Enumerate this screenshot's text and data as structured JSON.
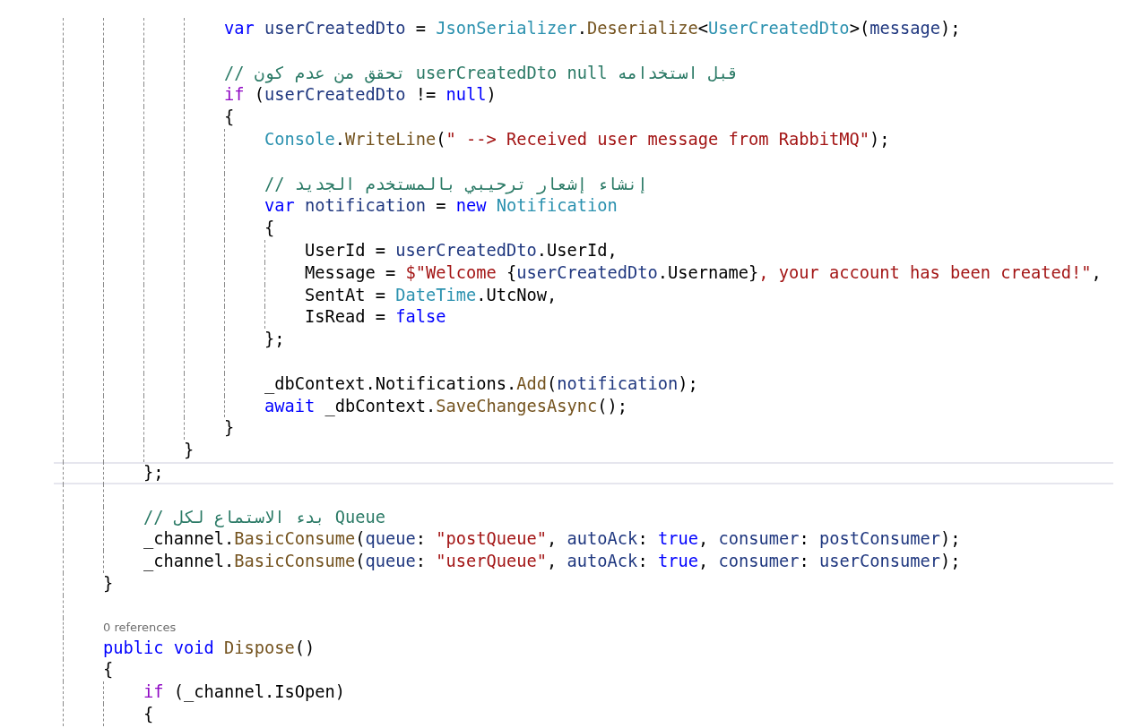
{
  "editor": {
    "lines": [
      {
        "kind": "block",
        "children": [
          {
            "kind": "block",
            "children": [
              {
                "kind": "block",
                "children": [
                  {
                    "kind": "block",
                    "children": [
                      {
                        "kind": "code",
                        "current": false,
                        "tokens": [
                          {
                            "kind": "keyword",
                            "text": "var"
                          },
                          {
                            "kind": "variable",
                            "text": " userCreatedDto"
                          },
                          {
                            "kind": "plain",
                            "text": " = "
                          },
                          {
                            "kind": "type",
                            "text": "JsonSerializer"
                          },
                          {
                            "kind": "plain",
                            "text": "."
                          },
                          {
                            "kind": "method",
                            "text": "Deserialize"
                          },
                          {
                            "kind": "plain",
                            "text": "<"
                          },
                          {
                            "kind": "type",
                            "text": "UserCreatedDto"
                          },
                          {
                            "kind": "plain",
                            "text": ">("
                          },
                          {
                            "kind": "variable",
                            "text": "message"
                          },
                          {
                            "kind": "plain",
                            "text": ");"
                          }
                        ]
                      },
                      {
                        "kind": "blank",
                        "current": false
                      },
                      {
                        "kind": "code",
                        "current": false,
                        "tokens": [
                          {
                            "kind": "comment",
                            "text": "// تحقق من عدم كون userCreatedDto null قبل استخدامه"
                          }
                        ]
                      },
                      {
                        "kind": "code",
                        "current": false,
                        "tokens": [
                          {
                            "kind": "control",
                            "text": "if"
                          },
                          {
                            "kind": "plain",
                            "text": " ("
                          },
                          {
                            "kind": "variable",
                            "text": "userCreatedDto"
                          },
                          {
                            "kind": "plain",
                            "text": " != "
                          },
                          {
                            "kind": "keyword",
                            "text": "null"
                          },
                          {
                            "kind": "plain",
                            "text": ")"
                          }
                        ]
                      },
                      {
                        "kind": "code",
                        "current": false,
                        "tokens": [
                          {
                            "kind": "plain",
                            "text": "{"
                          }
                        ]
                      },
                      {
                        "kind": "block",
                        "children": [
                          {
                            "kind": "code",
                            "current": false,
                            "tokens": [
                              {
                                "kind": "type",
                                "text": "Console"
                              },
                              {
                                "kind": "plain",
                                "text": "."
                              },
                              {
                                "kind": "method",
                                "text": "WriteLine"
                              },
                              {
                                "kind": "plain",
                                "text": "("
                              },
                              {
                                "kind": "string",
                                "text": "\" --> Received user message from RabbitMQ\""
                              },
                              {
                                "kind": "plain",
                                "text": ");"
                              }
                            ]
                          },
                          {
                            "kind": "blank",
                            "current": false
                          },
                          {
                            "kind": "code",
                            "current": false,
                            "tokens": [
                              {
                                "kind": "comment",
                                "text": "// إنشاء إشعار ترحيبي بالمستخدم الجديد"
                              }
                            ]
                          },
                          {
                            "kind": "code",
                            "current": false,
                            "tokens": [
                              {
                                "kind": "keyword",
                                "text": "var"
                              },
                              {
                                "kind": "variable",
                                "text": " notification"
                              },
                              {
                                "kind": "plain",
                                "text": " = "
                              },
                              {
                                "kind": "keyword",
                                "text": "new"
                              },
                              {
                                "kind": "type",
                                "text": " Notification"
                              }
                            ]
                          },
                          {
                            "kind": "code",
                            "current": false,
                            "tokens": [
                              {
                                "kind": "plain",
                                "text": "{"
                              }
                            ]
                          },
                          {
                            "kind": "block",
                            "children": [
                              {
                                "kind": "code",
                                "current": false,
                                "tokens": [
                                  {
                                    "kind": "plain",
                                    "text": "UserId = "
                                  },
                                  {
                                    "kind": "variable",
                                    "text": "userCreatedDto"
                                  },
                                  {
                                    "kind": "plain",
                                    "text": ".UserId,"
                                  }
                                ]
                              },
                              {
                                "kind": "code",
                                "current": false,
                                "tokens": [
                                  {
                                    "kind": "plain",
                                    "text": "Message = "
                                  },
                                  {
                                    "kind": "string",
                                    "text": "$\"Welcome "
                                  },
                                  {
                                    "kind": "plain",
                                    "text": "{"
                                  },
                                  {
                                    "kind": "variable",
                                    "text": "userCreatedDto"
                                  },
                                  {
                                    "kind": "plain",
                                    "text": ".Username}"
                                  },
                                  {
                                    "kind": "string",
                                    "text": ", your account has been created!\""
                                  },
                                  {
                                    "kind": "plain",
                                    "text": ","
                                  }
                                ]
                              },
                              {
                                "kind": "code",
                                "current": false,
                                "tokens": [
                                  {
                                    "kind": "plain",
                                    "text": "SentAt = "
                                  },
                                  {
                                    "kind": "type",
                                    "text": "DateTime"
                                  },
                                  {
                                    "kind": "plain",
                                    "text": ".UtcNow,"
                                  }
                                ]
                              },
                              {
                                "kind": "code",
                                "current": false,
                                "tokens": [
                                  {
                                    "kind": "plain",
                                    "text": "IsRead = "
                                  },
                                  {
                                    "kind": "keyword",
                                    "text": "false"
                                  }
                                ]
                              }
                            ]
                          },
                          {
                            "kind": "code",
                            "current": false,
                            "tokens": [
                              {
                                "kind": "plain",
                                "text": "};"
                              }
                            ]
                          },
                          {
                            "kind": "blank",
                            "current": false
                          },
                          {
                            "kind": "code",
                            "current": false,
                            "tokens": [
                              {
                                "kind": "plain",
                                "text": "_dbContext.Notifications."
                              },
                              {
                                "kind": "method",
                                "text": "Add"
                              },
                              {
                                "kind": "plain",
                                "text": "("
                              },
                              {
                                "kind": "variable",
                                "text": "notification"
                              },
                              {
                                "kind": "plain",
                                "text": ");"
                              }
                            ]
                          },
                          {
                            "kind": "code",
                            "current": false,
                            "tokens": [
                              {
                                "kind": "keyword",
                                "text": "await"
                              },
                              {
                                "kind": "plain",
                                "text": " _dbContext."
                              },
                              {
                                "kind": "method",
                                "text": "SaveChangesAsync"
                              },
                              {
                                "kind": "plain",
                                "text": "();"
                              }
                            ]
                          }
                        ]
                      },
                      {
                        "kind": "code",
                        "current": false,
                        "tokens": [
                          {
                            "kind": "plain",
                            "text": "}"
                          }
                        ]
                      }
                    ]
                  },
                  {
                    "kind": "code",
                    "current": false,
                    "tokens": [
                      {
                        "kind": "plain",
                        "text": "}"
                      }
                    ]
                  }
                ]
              },
              {
                "kind": "code",
                "current": true,
                "tokens": [
                  {
                    "kind": "plain",
                    "text": "};"
                  }
                ]
              },
              {
                "kind": "blank",
                "current": false
              },
              {
                "kind": "code",
                "current": false,
                "tokens": [
                  {
                    "kind": "comment",
                    "text": "// بدء الاستماع لكل Queue"
                  }
                ]
              },
              {
                "kind": "code",
                "current": false,
                "tokens": [
                  {
                    "kind": "plain",
                    "text": "_channel."
                  },
                  {
                    "kind": "method",
                    "text": "BasicConsume"
                  },
                  {
                    "kind": "plain",
                    "text": "("
                  },
                  {
                    "kind": "variable",
                    "text": "queue"
                  },
                  {
                    "kind": "plain",
                    "text": ": "
                  },
                  {
                    "kind": "string",
                    "text": "\"postQueue\""
                  },
                  {
                    "kind": "plain",
                    "text": ", "
                  },
                  {
                    "kind": "variable",
                    "text": "autoAck"
                  },
                  {
                    "kind": "plain",
                    "text": ": "
                  },
                  {
                    "kind": "keyword",
                    "text": "true"
                  },
                  {
                    "kind": "plain",
                    "text": ", "
                  },
                  {
                    "kind": "variable",
                    "text": "consumer"
                  },
                  {
                    "kind": "plain",
                    "text": ": "
                  },
                  {
                    "kind": "variable",
                    "text": "postConsumer"
                  },
                  {
                    "kind": "plain",
                    "text": ");"
                  }
                ]
              },
              {
                "kind": "code",
                "current": false,
                "tokens": [
                  {
                    "kind": "plain",
                    "text": "_channel."
                  },
                  {
                    "kind": "method",
                    "text": "BasicConsume"
                  },
                  {
                    "kind": "plain",
                    "text": "("
                  },
                  {
                    "kind": "variable",
                    "text": "queue"
                  },
                  {
                    "kind": "plain",
                    "text": ": "
                  },
                  {
                    "kind": "string",
                    "text": "\"userQueue\""
                  },
                  {
                    "kind": "plain",
                    "text": ", "
                  },
                  {
                    "kind": "variable",
                    "text": "autoAck"
                  },
                  {
                    "kind": "plain",
                    "text": ": "
                  },
                  {
                    "kind": "keyword",
                    "text": "true"
                  },
                  {
                    "kind": "plain",
                    "text": ", "
                  },
                  {
                    "kind": "variable",
                    "text": "consumer"
                  },
                  {
                    "kind": "plain",
                    "text": ": "
                  },
                  {
                    "kind": "variable",
                    "text": "userConsumer"
                  },
                  {
                    "kind": "plain",
                    "text": ");"
                  }
                ]
              }
            ]
          },
          {
            "kind": "code",
            "current": false,
            "tokens": [
              {
                "kind": "plain",
                "text": "}"
              }
            ]
          },
          {
            "kind": "blank",
            "current": false
          },
          {
            "kind": "codelens",
            "current": false,
            "text": "0 references"
          },
          {
            "kind": "code",
            "current": false,
            "tokens": [
              {
                "kind": "keyword",
                "text": "public"
              },
              {
                "kind": "keyword",
                "text": " void"
              },
              {
                "kind": "method",
                "text": " Dispose"
              },
              {
                "kind": "plain",
                "text": "()"
              }
            ]
          },
          {
            "kind": "code",
            "current": false,
            "tokens": [
              {
                "kind": "plain",
                "text": "{"
              }
            ]
          },
          {
            "kind": "block",
            "children": [
              {
                "kind": "code",
                "current": false,
                "tokens": [
                  {
                    "kind": "control",
                    "text": "if"
                  },
                  {
                    "kind": "plain",
                    "text": " (_channel.IsOpen)"
                  }
                ]
              },
              {
                "kind": "code",
                "current": false,
                "tokens": [
                  {
                    "kind": "plain",
                    "text": "{"
                  }
                ]
              }
            ]
          }
        ]
      }
    ]
  }
}
